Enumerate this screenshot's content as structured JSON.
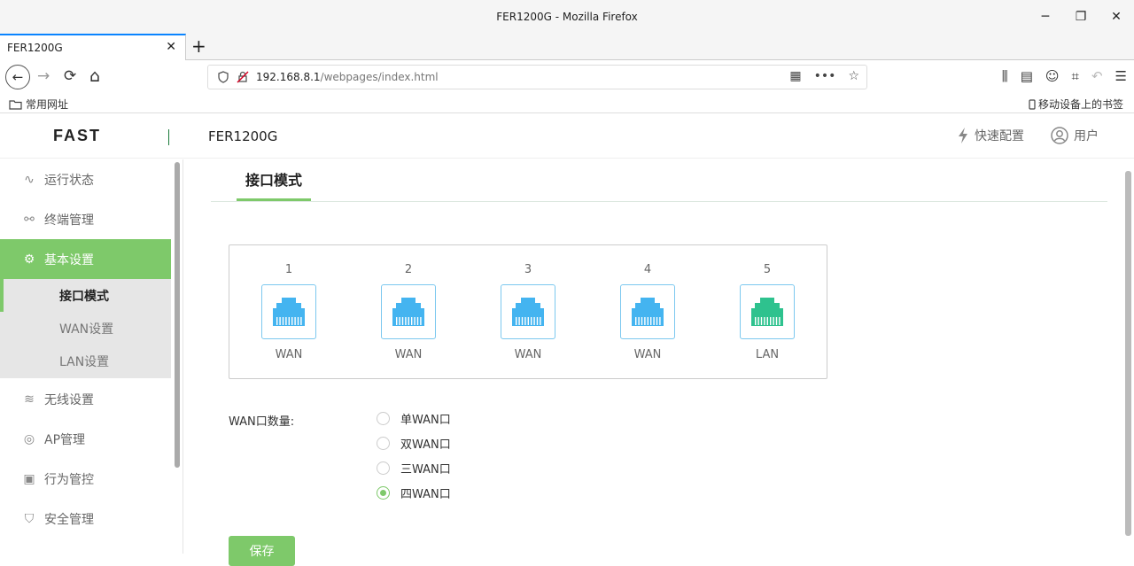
{
  "window": {
    "title": "FER1200G - Mozilla Firefox",
    "minimize": "─",
    "maximize": "❐",
    "close": "✕"
  },
  "tab": {
    "title": "FER1200G",
    "close": "✕",
    "new_tab": "+"
  },
  "nav": {
    "back": "←",
    "forward": "→",
    "reload": "⟳",
    "home": "⌂",
    "url_host": "192.168.8.1",
    "url_path": "/webpages/index.html",
    "qr": "▦",
    "more": "•••",
    "star": "☆",
    "toolbar": [
      "⫼",
      "▤",
      "☺",
      "⌗",
      "↶",
      "☰"
    ]
  },
  "bookmarks": {
    "left_label": "常用网址",
    "right_label": "移动设备上的书签"
  },
  "header": {
    "brand": "FAST",
    "model": "FER1200G",
    "quick_setup": "快速配置",
    "user": "用户"
  },
  "sidebar": {
    "items": [
      {
        "label": "运行状态",
        "icon": "status-icon",
        "glyph": "∿"
      },
      {
        "label": "终端管理",
        "icon": "terminal-icon",
        "glyph": "⚯"
      },
      {
        "label": "基本设置",
        "icon": "gear-icon",
        "glyph": "⚙"
      },
      {
        "label": "无线设置",
        "icon": "wifi-icon",
        "glyph": "≋"
      },
      {
        "label": "AP管理",
        "icon": "ap-icon",
        "glyph": "◎"
      },
      {
        "label": "行为管控",
        "icon": "control-icon",
        "glyph": "▣"
      },
      {
        "label": "安全管理",
        "icon": "shield-icon",
        "glyph": "⛉"
      }
    ],
    "sub_items": [
      "接口模式",
      "WAN设置",
      "LAN设置"
    ]
  },
  "main": {
    "tab_label": "接口模式",
    "ports": [
      {
        "num": "1",
        "type": "WAN",
        "color": "#44b4f0"
      },
      {
        "num": "2",
        "type": "WAN",
        "color": "#44b4f0"
      },
      {
        "num": "3",
        "type": "WAN",
        "color": "#44b4f0"
      },
      {
        "num": "4",
        "type": "WAN",
        "color": "#44b4f0"
      },
      {
        "num": "5",
        "type": "LAN",
        "color": "#2ec28e"
      }
    ],
    "wan_count_label": "WAN口数量:",
    "options": [
      {
        "label": "单WAN口",
        "checked": false
      },
      {
        "label": "双WAN口",
        "checked": false
      },
      {
        "label": "三WAN口",
        "checked": false
      },
      {
        "label": "四WAN口",
        "checked": true
      }
    ],
    "save_label": "保存"
  },
  "colors": {
    "accent": "#7ec96a",
    "wan_port": "#44b4f0",
    "lan_port": "#2ec28e"
  }
}
